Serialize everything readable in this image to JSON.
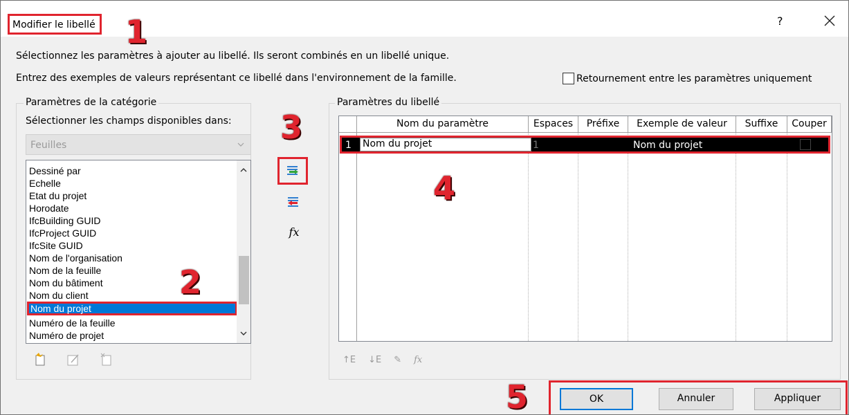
{
  "dialog": {
    "title": "Modifier le libellé",
    "help_label": "?",
    "description_line1": "Sélectionnez les paramètres à ajouter au libellé. Ils seront combinés en un libellé unique.",
    "description_line2": "Entrez des exemples de valeurs représentant ce libellé dans l'environnement de la famille.",
    "checkbox_label": "Retournement entre les paramètres uniquement",
    "checkbox_checked": false
  },
  "category_params": {
    "group_label": "Paramètres de la catégorie",
    "select_label": "Sélectionner les champs disponibles dans:",
    "combo_value": "Feuilles",
    "items": [
      "Dessiné par",
      "Echelle",
      "Etat du projet",
      "Horodate",
      "IfcBuilding GUID",
      "IfcProject GUID",
      "IfcSite GUID",
      "Nom de l'organisation",
      "Nom de la feuille",
      "Nom du bâtiment",
      "Nom du client",
      "Nom du projet",
      "Numéro de la feuille",
      "Numéro de projet"
    ],
    "selected_item": "Nom du projet"
  },
  "mid_buttons": {
    "fx_label": "fx"
  },
  "label_params": {
    "group_label": "Paramètres du libellé",
    "columns": [
      "Nom du paramètre",
      "Espaces",
      "Préfixe",
      "Exemple de valeur",
      "Suffixe",
      "Couper"
    ],
    "rows": [
      {
        "index": "1",
        "name": "Nom du projet",
        "spaces": "1",
        "prefix": "",
        "example": "Nom du projet",
        "suffix": "",
        "wrap": false
      }
    ]
  },
  "footer": {
    "ok": "OK",
    "cancel": "Annuler",
    "apply": "Appliquer"
  },
  "callouts": {
    "n1": "1",
    "n2": "2",
    "n3": "3",
    "n4": "4",
    "n5": "5"
  },
  "colors": {
    "highlight_red": "#e0242e",
    "selection_blue": "#0078d7"
  }
}
